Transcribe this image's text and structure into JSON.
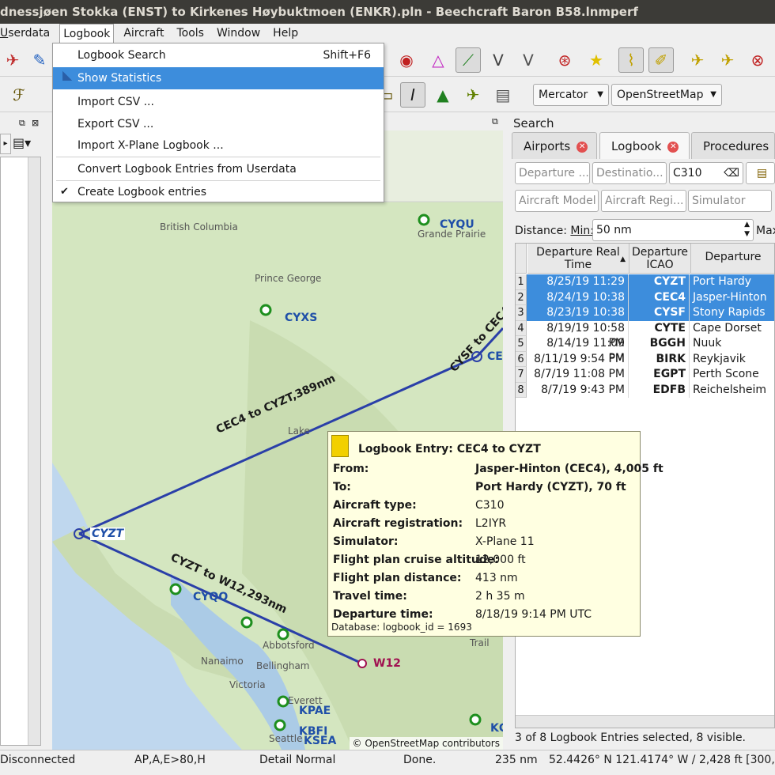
{
  "window": {
    "title": "dnessjøen Stokka (ENST) to Kirkenes Høybuktmoen (ENKR).pln - Beechcraft Baron B58.lnmperf"
  },
  "menubar": {
    "items": [
      {
        "label": "serdata",
        "mn": "U"
      },
      {
        "label": "Logbook"
      },
      {
        "label": "Aircraft"
      },
      {
        "label": "Tools"
      },
      {
        "label": "Window"
      },
      {
        "label": "Help"
      }
    ]
  },
  "logbook_menu": {
    "items": [
      {
        "label": "Logbook Search",
        "shortcut": "Shift+F6"
      },
      {
        "label": "Show Statistics",
        "shortcut": ""
      },
      {
        "label": "Import CSV ...",
        "shortcut": ""
      },
      {
        "label": "Export CSV ...",
        "shortcut": ""
      },
      {
        "label": "Import X-Plane Logbook ...",
        "shortcut": ""
      },
      {
        "label": "Convert Logbook Entries from Userdata",
        "shortcut": ""
      },
      {
        "label": "Create Logbook entries",
        "shortcut": "",
        "checked": true
      }
    ]
  },
  "toolbar2": {
    "projection": "Mercator",
    "theme": "OpenStreetMap"
  },
  "map": {
    "labels": [
      "British Columbia",
      "Grande Prairie",
      "Prince George",
      "Nanaimo",
      "Abbotsford",
      "Bellingham",
      "Victoria",
      "Trail",
      "Lake",
      "Everett",
      "Seattle"
    ],
    "airports": [
      "CYQU",
      "CYXS",
      "CYZT",
      "CYQQ",
      "CE",
      "W12",
      "KPAE",
      "KBFI",
      "KSEA",
      "KG"
    ],
    "routes": [
      "CEC4 to CYZT,389nm",
      "CYSF to CEC4",
      "CYZT to W12,293nm"
    ],
    "copyright": "© OpenStreetMap contributors"
  },
  "tooltip": {
    "title": "Logbook Entry: CEC4 to CYZT",
    "rows": [
      {
        "k": "From:",
        "v": "Jasper-Hinton (CEC4), 4,005 ft",
        "bold": true
      },
      {
        "k": "To:",
        "v": "Port Hardy (CYZT), 70 ft",
        "bold": true
      },
      {
        "k": "Aircraft type:",
        "v": "C310"
      },
      {
        "k": "Aircraft registration:",
        "v": "L2IYR"
      },
      {
        "k": "Simulator:",
        "v": "X-Plane 11"
      },
      {
        "k": "Flight plan cruise altitude:",
        "v": "12,000 ft"
      },
      {
        "k": "Flight plan distance:",
        "v": "413 nm"
      },
      {
        "k": "Travel time:",
        "v": "2 h 35 m"
      },
      {
        "k": "Departure time:",
        "v": "8/18/19 9:14 PM UTC"
      }
    ],
    "footer": "Database: logbook_id = 1693"
  },
  "search": {
    "title": "Search",
    "tabs": [
      "Airports",
      "Logbook",
      "Procedures"
    ],
    "fields": {
      "departure": "Departure ...",
      "destination": "Destinatio...",
      "aircraft_type": "C310",
      "aircraft_model": "Aircraft Model",
      "aircraft_reg": "Aircraft Regi...",
      "simulator": "Simulator",
      "distance_label": "Distance:",
      "min_label": "Min:",
      "min_value": "50 nm",
      "max_label": "Max"
    },
    "columns": [
      "Departure Real Time",
      "Departure ICAO",
      "Departure"
    ],
    "rows": [
      {
        "n": "1",
        "time": "8/25/19 11:29 PM",
        "icao": "CYZT",
        "name": "Port Hardy",
        "sel": true
      },
      {
        "n": "2",
        "time": "8/24/19 10:38 PM",
        "icao": "CEC4",
        "name": "Jasper-Hinton",
        "sel": true
      },
      {
        "n": "3",
        "time": "8/23/19 10:38 PM",
        "icao": "CYSF",
        "name": "Stony Rapids",
        "sel": true
      },
      {
        "n": "4",
        "time": "8/19/19 10:58 PM",
        "icao": "CYTE",
        "name": "Cape Dorset",
        "sel": false
      },
      {
        "n": "5",
        "time": "8/14/19 11:09 PM",
        "icao": "BGGH",
        "name": "Nuuk",
        "sel": false
      },
      {
        "n": "6",
        "time": "8/11/19 9:54 PM",
        "icao": "BIRK",
        "name": "Reykjavik",
        "sel": false
      },
      {
        "n": "7",
        "time": "8/7/19 11:08 PM",
        "icao": "EGPT",
        "name": "Perth Scone",
        "sel": false
      },
      {
        "n": "8",
        "time": "8/7/19 9:43 PM",
        "icao": "EDFB",
        "name": "Reichelsheim",
        "sel": false
      }
    ],
    "status": "3 of 8 Logbook Entries selected, 8 visible."
  },
  "statusbar": {
    "connection": "Disconnected",
    "ap": "AP,A,E>80,H",
    "detail": "Detail Normal",
    "done": "Done.",
    "distance": "235 nm",
    "coords": "52.4426° N 121.4174° W / 2,428 ft [300,314"
  },
  "colors": {
    "selection": "#3d8ddc",
    "title_bg": "#3c3b37",
    "route": "#2a3fa8",
    "tooltip_bg": "#ffffe1"
  }
}
